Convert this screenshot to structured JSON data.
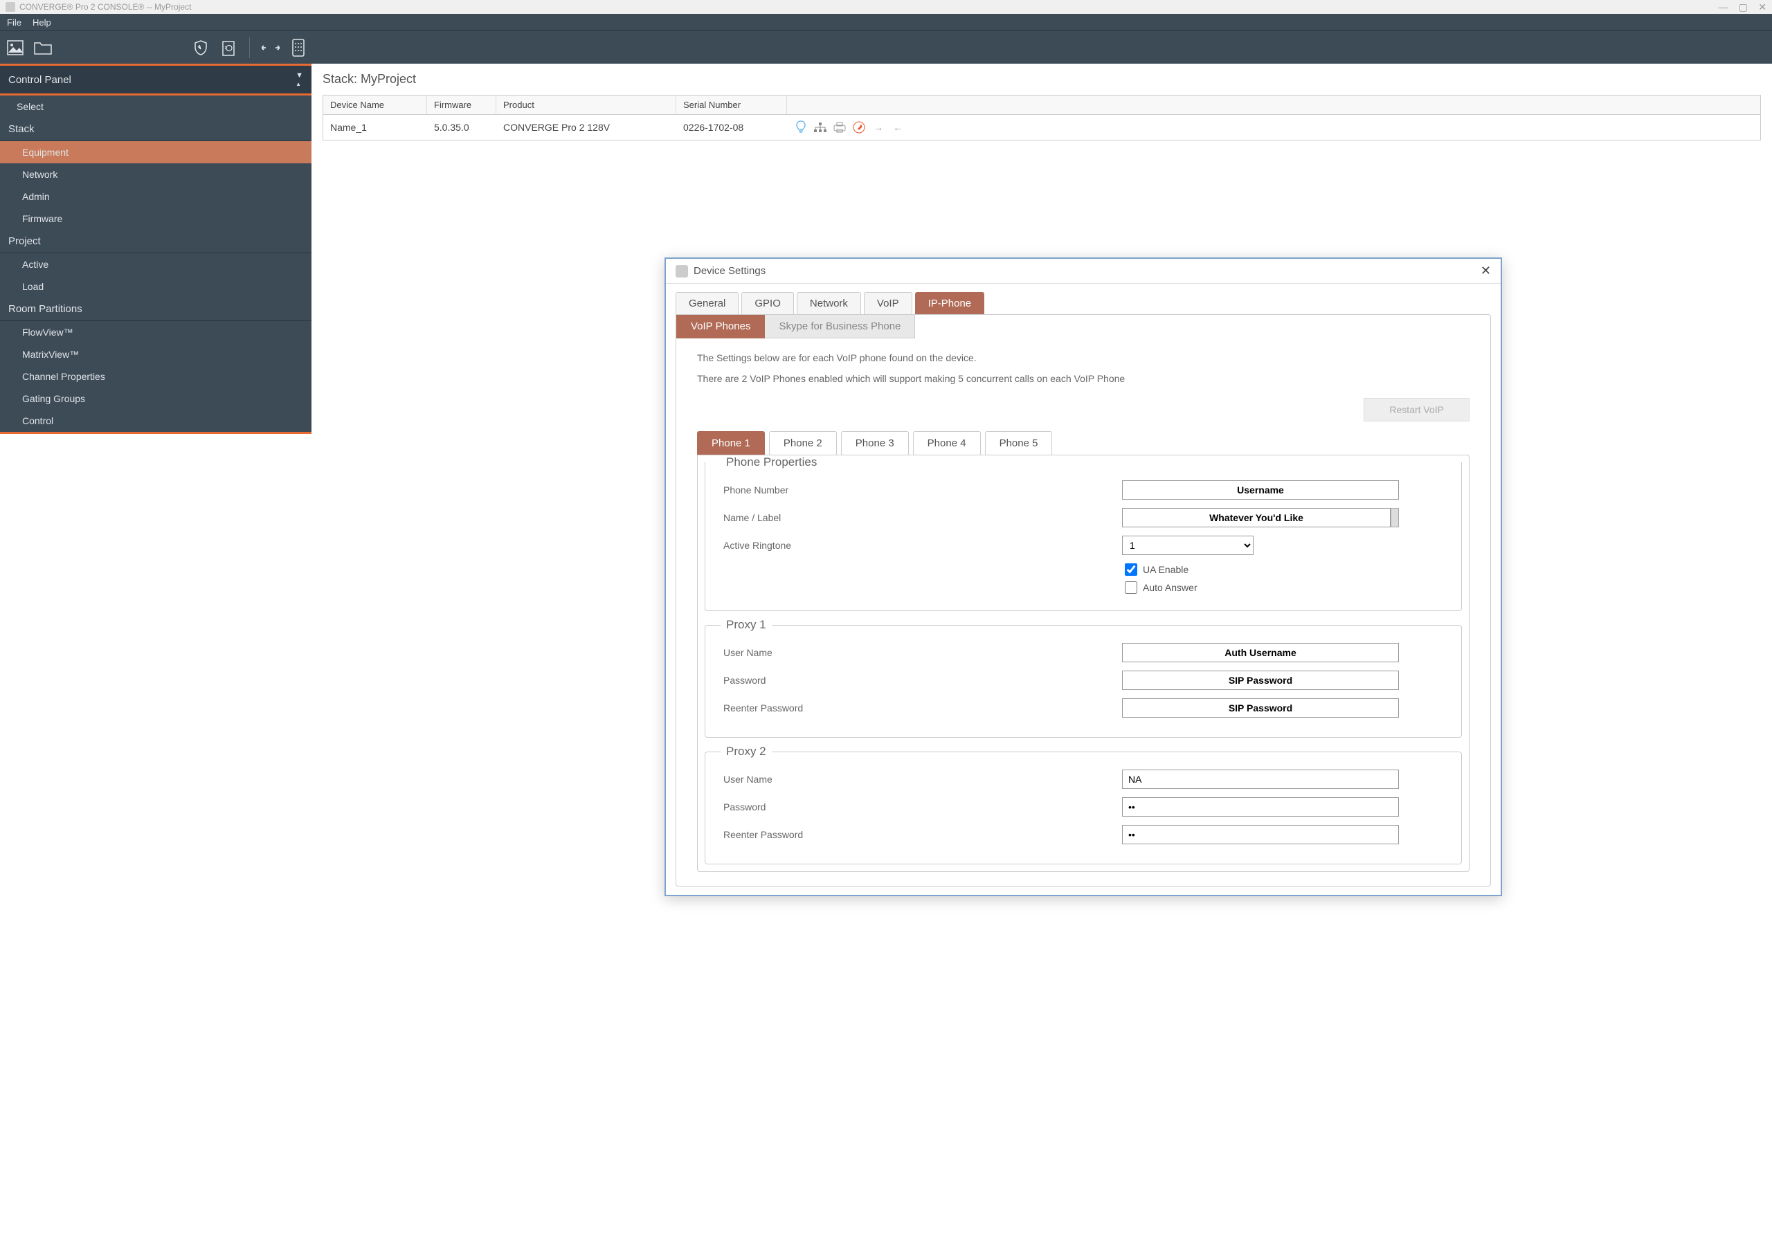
{
  "title_bar": "CONVERGE® Pro 2 CONSOLE® -- MyProject",
  "menu": {
    "file": "File",
    "help": "Help"
  },
  "sidebar": {
    "header": "Control Panel",
    "select": "Select",
    "stack": {
      "title": "Stack",
      "items": [
        "Equipment",
        "Network",
        "Admin",
        "Firmware"
      ]
    },
    "project": {
      "title": "Project",
      "items": [
        "Active",
        "Load"
      ]
    },
    "room": {
      "title": "Room Partitions",
      "items": [
        "FlowView™",
        "MatrixView™",
        "Channel Properties",
        "Gating Groups",
        "Control"
      ]
    }
  },
  "main": {
    "stack_title": "Stack: MyProject",
    "table": {
      "headers": {
        "name": "Device Name",
        "fw": "Firmware",
        "prod": "Product",
        "sn": "Serial Number"
      },
      "row": {
        "name": "Name_1",
        "fw": "5.0.35.0",
        "prod": "CONVERGE Pro 2 128V",
        "sn": "0226-1702-08"
      }
    }
  },
  "dialog": {
    "title": "Device Settings",
    "tabs": [
      "General",
      "GPIO",
      "Network",
      "VoIP",
      "IP-Phone"
    ],
    "subtabs": [
      "VoIP Phones",
      "Skype for Business Phone"
    ],
    "desc1": "The Settings below are for each VoIP phone found on the device.",
    "desc2": "There are 2 VoIP Phones enabled which will support making 5 concurrent calls on each VoIP Phone",
    "restart": "Restart VoIP",
    "phone_tabs": [
      "Phone 1",
      "Phone 2",
      "Phone 3",
      "Phone 4",
      "Phone 5"
    ],
    "phone_props": {
      "legend": "Phone Properties",
      "phone_number": "Phone Number",
      "name_label": "Name / Label",
      "active_ringtone": "Active Ringtone",
      "ua_enable": "UA Enable",
      "auto_answer": "Auto Answer",
      "phone_number_val": "Username",
      "name_label_val": "Whatever You'd Like",
      "ringtone_val": "1"
    },
    "proxy1": {
      "legend": "Proxy 1",
      "user": "User Name",
      "pass": "Password",
      "repass": "Reenter Password",
      "user_val": "Auth Username",
      "pass_val": "SIP Password",
      "repass_val": "SIP Password"
    },
    "proxy2": {
      "legend": "Proxy 2",
      "user": "User Name",
      "pass": "Password",
      "repass": "Reenter Password",
      "user_val": "NA",
      "pass_val": "••",
      "repass_val": "••"
    }
  }
}
